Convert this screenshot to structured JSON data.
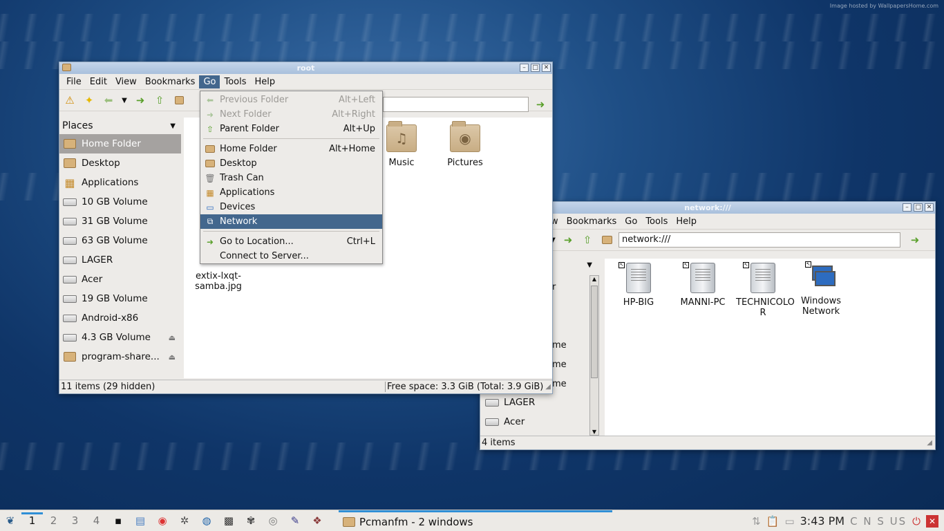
{
  "desktop": {
    "watermark": "Image hosted by WallpapersHome.com"
  },
  "window_root": {
    "title": "root",
    "menu": [
      "File",
      "Edit",
      "View",
      "Bookmarks",
      "Go",
      "Tools",
      "Help"
    ],
    "active_menu": "Go",
    "sidebar": {
      "header": "Places",
      "items": [
        {
          "label": "Home Folder",
          "icon": "home-folder-icon",
          "selected": true
        },
        {
          "label": "Desktop",
          "icon": "desktop-folder-icon"
        },
        {
          "label": "Applications",
          "icon": "applications-icon"
        },
        {
          "label": "10 GB Volume",
          "icon": "drive-icon"
        },
        {
          "label": "31 GB Volume",
          "icon": "drive-icon"
        },
        {
          "label": "63 GB Volume",
          "icon": "drive-icon"
        },
        {
          "label": "LAGER",
          "icon": "drive-icon"
        },
        {
          "label": "Acer",
          "icon": "drive-icon"
        },
        {
          "label": "19 GB Volume",
          "icon": "drive-icon"
        },
        {
          "label": "Android-x86",
          "icon": "drive-icon"
        },
        {
          "label": "4.3 GB Volume",
          "icon": "drive-icon",
          "eject": true
        },
        {
          "label": "program-share...",
          "icon": "folder-icon",
          "eject": true
        }
      ]
    },
    "files": [
      {
        "label": "Music",
        "icon": "music-folder-icon"
      },
      {
        "label": "Pictures",
        "icon": "pictures-folder-icon"
      },
      {
        "label": "extix-lxqt-samba.jpg",
        "line1": "extix-lxqt-",
        "line2": "samba.jpg",
        "icon": "image-file-icon"
      }
    ],
    "status_left": "11 items (29 hidden)",
    "status_right": "Free space: 3.3 GiB (Total: 3.9 GiB)"
  },
  "go_menu": {
    "items": [
      {
        "label": "Previous Folder",
        "accel": "Alt+Left",
        "disabled": true,
        "icon": "back-arrow-icon"
      },
      {
        "label": "Next Folder",
        "accel": "Alt+Right",
        "disabled": true,
        "icon": "forward-arrow-icon"
      },
      {
        "label": "Parent Folder",
        "accel": "Alt+Up",
        "icon": "up-arrow-icon"
      },
      {
        "sep": true
      },
      {
        "label": "Home Folder",
        "accel": "Alt+Home",
        "icon": "folder-icon"
      },
      {
        "label": "Desktop",
        "accel": "",
        "icon": "folder-icon"
      },
      {
        "label": "Trash Can",
        "accel": "",
        "icon": "trash-icon"
      },
      {
        "label": "Applications",
        "accel": "",
        "icon": "applications-icon"
      },
      {
        "label": "Devices",
        "accel": "",
        "icon": "computer-icon"
      },
      {
        "label": "Network",
        "accel": "",
        "icon": "network-icon",
        "highlight": true
      },
      {
        "sep": true
      },
      {
        "label": "Go to Location...",
        "accel": "Ctrl+L",
        "icon": "go-icon"
      },
      {
        "label": "Connect to Server...",
        "accel": "",
        "icon": ""
      }
    ]
  },
  "window_network": {
    "title": "network:///",
    "menu_partial": "w",
    "menu": [
      "Bookmarks",
      "Go",
      "Tools",
      "Help"
    ],
    "path": "network:///",
    "sidebar_partial": [
      "r",
      "",
      "",
      "me",
      "me",
      "me"
    ],
    "sidebar_items": [
      "LAGER",
      "Acer"
    ],
    "hosts": [
      {
        "line1": "HP-BIG",
        "line2": "",
        "icon": "server-icon"
      },
      {
        "line1": "MANNI-PC",
        "line2": "",
        "icon": "server-icon"
      },
      {
        "line1": "TECHNICOLO",
        "line2": "R",
        "icon": "server-icon"
      },
      {
        "line1": "Windows",
        "line2": "Network",
        "icon": "network-computers-icon"
      }
    ],
    "status": "4 items"
  },
  "taskbar": {
    "desktops": [
      "1",
      "2",
      "3",
      "4"
    ],
    "task_label": "Pcmanfm - 2 windows",
    "clock": "3:43 PM",
    "keyboard": "C N S US"
  }
}
